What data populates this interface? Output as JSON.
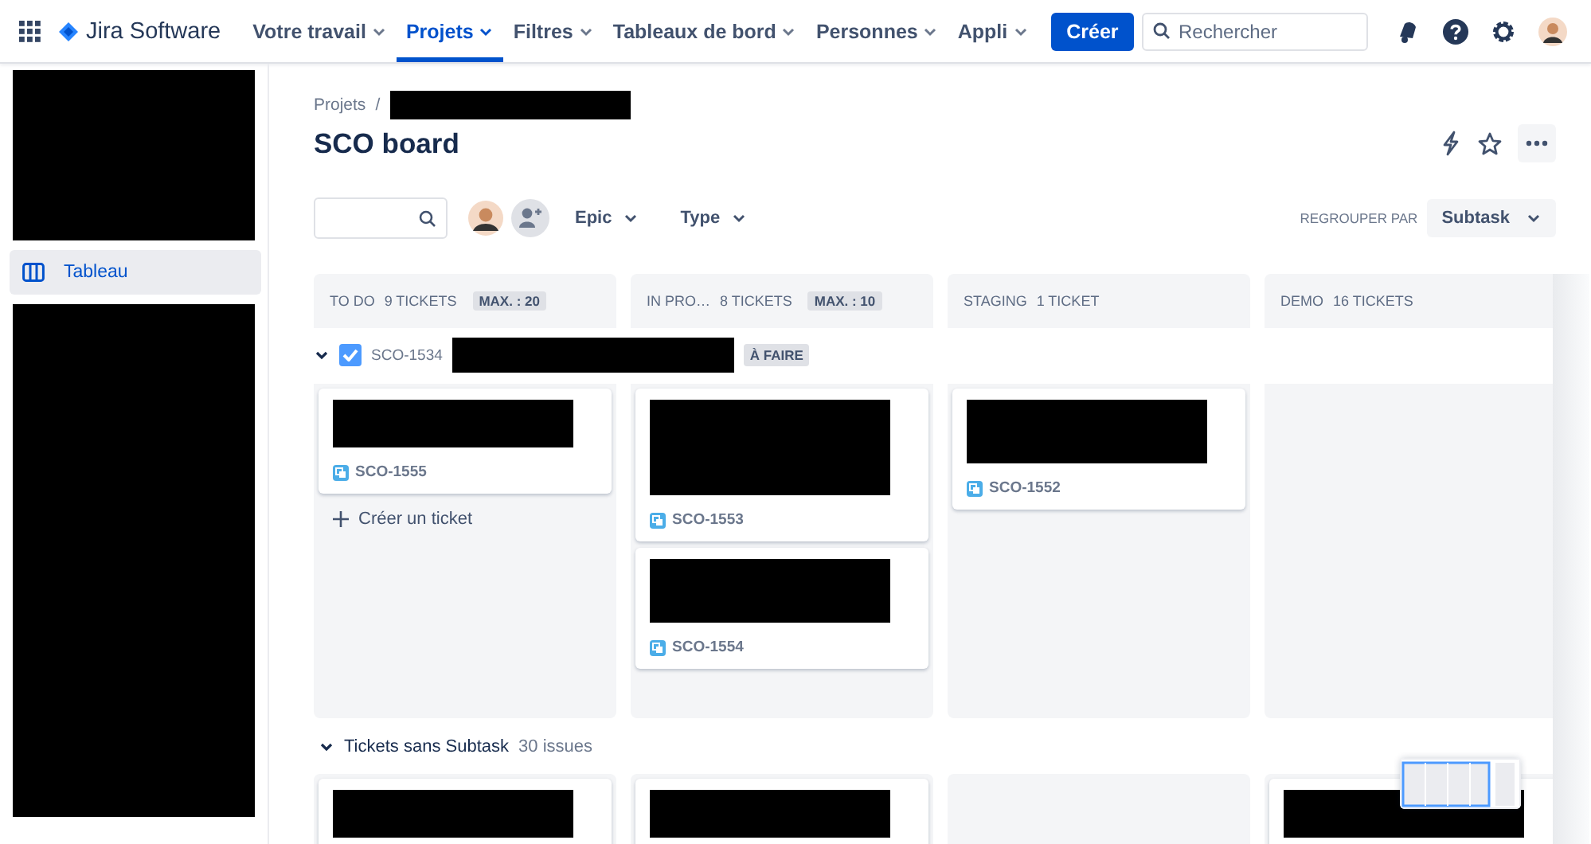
{
  "nav": {
    "product": "Jira Software",
    "menu": [
      {
        "label": "Votre travail",
        "selected": false
      },
      {
        "label": "Projets",
        "selected": true
      },
      {
        "label": "Filtres",
        "selected": false
      },
      {
        "label": "Tableaux de bord",
        "selected": false
      },
      {
        "label": "Personnes",
        "selected": false
      },
      {
        "label": "Appli",
        "selected": false
      }
    ],
    "create": "Créer",
    "search": {
      "placeholder": "Rechercher"
    }
  },
  "sidebar": {
    "items": [
      {
        "label": "Tableau",
        "selected": true
      }
    ]
  },
  "breadcrumb": {
    "root": "Projets",
    "separator": "/"
  },
  "title": "SCO board",
  "toolbar": {
    "filters": [
      "Epic",
      "Type"
    ],
    "group_by_label": "REGROUPER PAR",
    "group_by": "Subtask"
  },
  "columns": [
    {
      "name": "TO DO",
      "count": "9 TICKETS",
      "max": "MAX. : 20"
    },
    {
      "name": "IN PRO…",
      "count": "8 TICKETS",
      "max": "MAX. : 10"
    },
    {
      "name": "STAGING",
      "count": "1 TICKET"
    },
    {
      "name": "DEMO",
      "count": "16 TICKETS"
    }
  ],
  "swimlanes": [
    {
      "kind": "parent",
      "expanded": true,
      "checked": true,
      "key": "SCO-1534",
      "status": "À FAIRE",
      "create_label": "Créer un ticket",
      "cells": [
        [
          {
            "key": "SCO-1555"
          }
        ],
        [
          {
            "key": "SCO-1553"
          },
          {
            "key": "SCO-1554"
          }
        ],
        [
          {
            "key": "SCO-1552"
          }
        ],
        []
      ]
    },
    {
      "kind": "group",
      "expanded": true,
      "title": "Tickets sans Subtask",
      "count": "30 issues"
    }
  ]
}
